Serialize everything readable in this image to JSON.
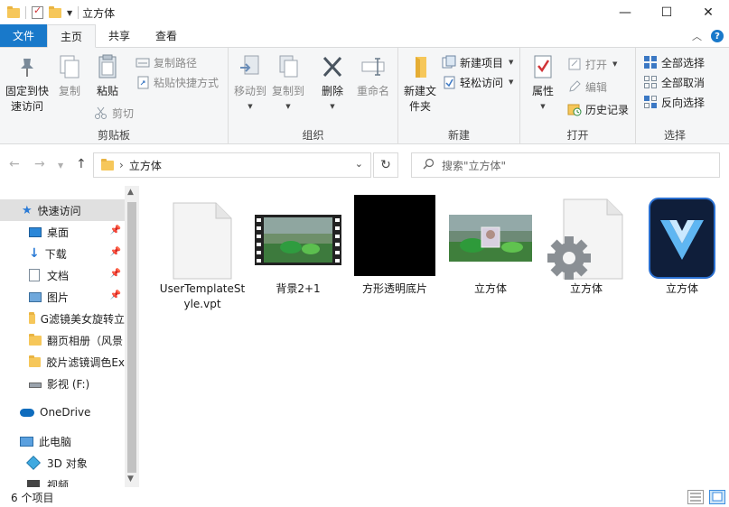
{
  "window": {
    "title": "立方体",
    "controls": [
      "—",
      "☐",
      "✕"
    ]
  },
  "ribbon_tabs": [
    {
      "label": "文件"
    },
    {
      "label": "主页"
    },
    {
      "label": "共享"
    },
    {
      "label": "查看"
    }
  ],
  "ribbon": {
    "clipboard": {
      "label": "剪贴板",
      "pin_label": "固定到快速访问",
      "copy_label": "复制",
      "paste_label": "粘贴",
      "copy_path_label": "复制路径",
      "paste_shortcut_label": "粘贴快捷方式",
      "cut_label": "剪切"
    },
    "organize": {
      "label": "组织",
      "move_to_label": "移动到",
      "copy_to_label": "复制到",
      "delete_label": "删除",
      "rename_label": "重命名"
    },
    "new": {
      "label": "新建",
      "new_folder_label": "新建文件夹",
      "new_item_label": "新建项目",
      "easy_access_label": "轻松访问"
    },
    "open": {
      "label": "打开",
      "properties_label": "属性",
      "open_label": "打开",
      "edit_label": "编辑",
      "history_label": "历史记录"
    },
    "select": {
      "label": "选择",
      "select_all_label": "全部选择",
      "select_none_label": "全部取消",
      "invert_label": "反向选择"
    }
  },
  "address": {
    "path": "立方体",
    "search_placeholder": "搜索\"立方体\""
  },
  "nav": {
    "items": [
      {
        "label": "快速访问",
        "icon": "star-icon"
      },
      {
        "label": "桌面",
        "icon": "desktop-icon",
        "pinned": true
      },
      {
        "label": "下载",
        "icon": "download-icon",
        "pinned": true
      },
      {
        "label": "文档",
        "icon": "document-icon",
        "pinned": true
      },
      {
        "label": "图片",
        "icon": "picture-icon",
        "pinned": true
      },
      {
        "label": "G滤镜美女旋转立",
        "icon": "folder-icon"
      },
      {
        "label": "翻页相册（风景",
        "icon": "folder-icon"
      },
      {
        "label": "胶片滤镜调色Ex",
        "icon": "folder-icon"
      },
      {
        "label": "影视 (F:)",
        "icon": "drive-icon"
      },
      {
        "label": "OneDrive",
        "icon": "cloud-icon"
      },
      {
        "label": "此电脑",
        "icon": "computer-icon"
      },
      {
        "label": "3D 对象",
        "icon": "cube-3d-icon"
      },
      {
        "label": "视频",
        "icon": "video-icon"
      }
    ]
  },
  "files": [
    {
      "name": "UserTemplateStyle.vpt",
      "icon": "blank-file-icon"
    },
    {
      "name": "背景2+1",
      "icon": "video-thumbnail-icon"
    },
    {
      "name": "方形透明底片",
      "icon": "black-image-thumbnail"
    },
    {
      "name": "立方体",
      "icon": "image-thumbnail"
    },
    {
      "name": "立方体",
      "icon": "settings-file-icon"
    },
    {
      "name": "立方体",
      "icon": "app-logo-icon"
    }
  ],
  "status": {
    "item_count": "6 个项目"
  },
  "colors": {
    "accent": "#1979ca",
    "folder": "#f6c75a",
    "ribbon_bg": "#f5f6f7"
  }
}
